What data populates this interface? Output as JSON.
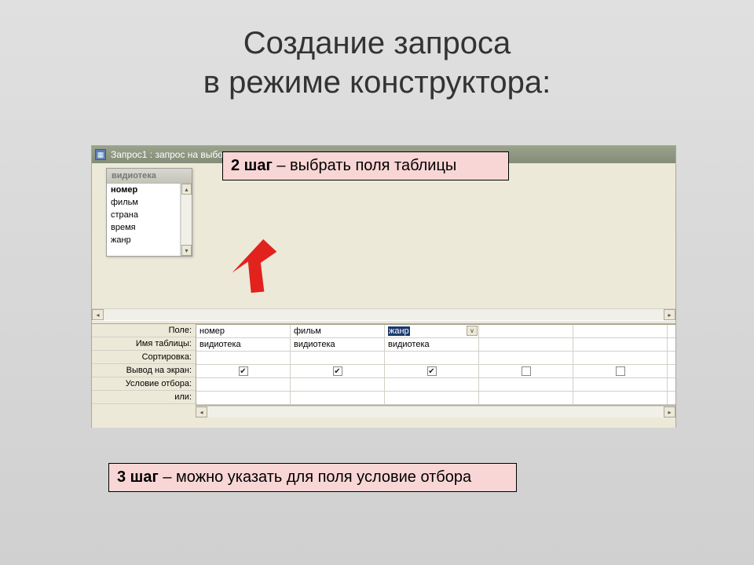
{
  "slide": {
    "title_line1": "Создание запроса",
    "title_line2": "в режиме конструктора:"
  },
  "callouts": {
    "step2_bold": "2 шаг",
    "step2_rest": " – выбрать поля таблицы",
    "step3_bold": "3 шаг",
    "step3_rest": " – можно указать для поля условие отбора"
  },
  "window": {
    "title": "Запрос1 : запрос на выборку"
  },
  "table_box": {
    "title": "видиотека",
    "fields": [
      "номер",
      "фильм",
      "страна",
      "время",
      "жанр"
    ]
  },
  "grid": {
    "row_labels": [
      "Поле:",
      "Имя таблицы:",
      "Сортировка:",
      "Вывод на экран:",
      "Условие отбора:",
      "или:"
    ],
    "columns": [
      {
        "field": "номер",
        "table": "видиотека",
        "show": true,
        "active": false
      },
      {
        "field": "фильм",
        "table": "видиотека",
        "show": true,
        "active": false
      },
      {
        "field": "жанр",
        "table": "видиотека",
        "show": true,
        "active": true
      },
      {
        "field": "",
        "table": "",
        "show": false,
        "active": false
      },
      {
        "field": "",
        "table": "",
        "show": false,
        "active": false
      }
    ]
  },
  "icons": {
    "scroll_up": "▴",
    "scroll_down": "▾",
    "scroll_left": "◂",
    "scroll_right": "▸",
    "dropdown": "v",
    "check": "✔"
  }
}
